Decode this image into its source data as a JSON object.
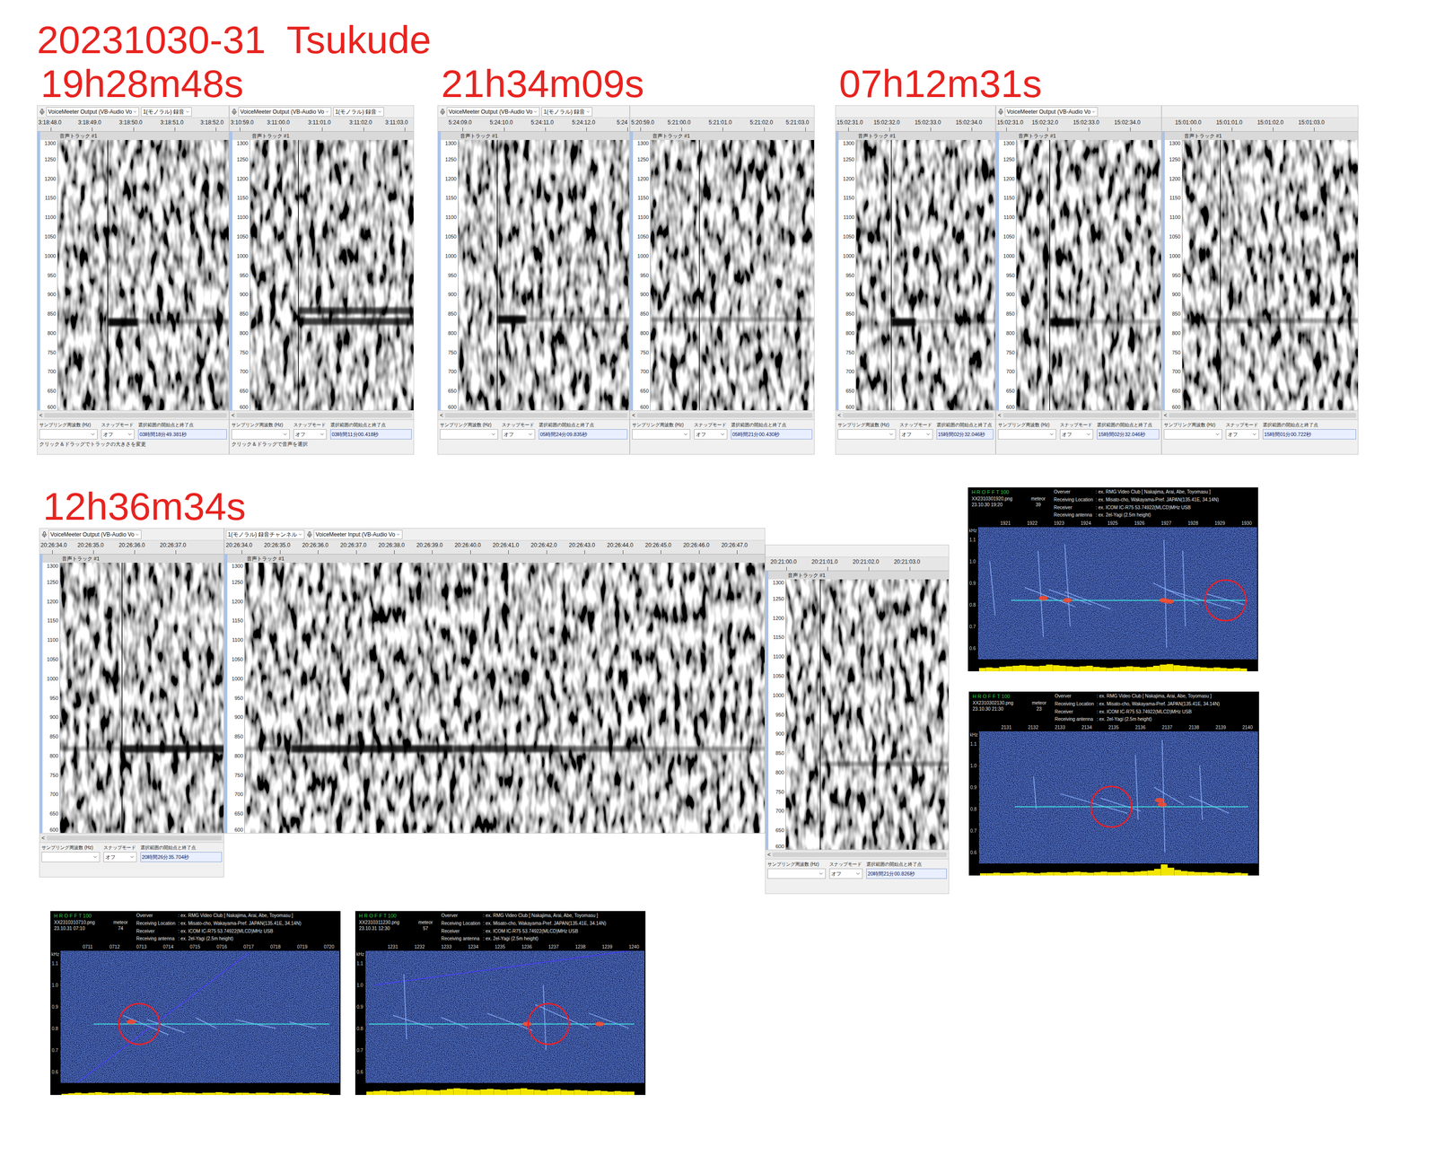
{
  "title": "20231030-31  Tsukude",
  "spectrogram_common": {
    "y_ticks": [
      "1300",
      "1250",
      "1200",
      "1150",
      "1100",
      "1050",
      "1000",
      "950",
      "900",
      "850",
      "800",
      "750",
      "700",
      "650",
      "600"
    ],
    "track_label": "音声トラック #1",
    "scroll_arrow": "<",
    "rate_label": "サンプリング周波数 (Hz)",
    "snap_label": "スナップモード",
    "selection_label": "選択範囲の開始点と終了点",
    "snap_value": "オフ"
  },
  "events": [
    {
      "label": "19h28m48s",
      "panels": [
        {
          "toolbar": [
            {
              "kind": "device",
              "text": "VoiceMeeter Output (VB-Audio Vo"
            },
            {
              "kind": "channels",
              "text": "1(モノラル) 録音"
            }
          ],
          "span": 4.67,
          "first_tick": 0.33,
          "ticks": [
            "3:18:48.0",
            "3:18:49.0",
            "3:18:50.0",
            "3:18:51.0",
            "3:18:52.0"
          ],
          "cursor": 1.71,
          "echoes": [
            {
              "from": 1.71,
              "to": 2.45,
              "freq": 828,
              "strength": 0.95
            },
            {
              "from": 2.45,
              "to": 4.67,
              "freq": 830,
              "strength": 0.3
            }
          ],
          "bottom": {
            "selection": "03時間18分49.381秒",
            "status": "クリック＆ドラッグでトラックの大きさを変更"
          }
        },
        {
          "toolbar": [
            {
              "kind": "device",
              "text": "VoiceMeeter Output (VB-Audio Vo"
            },
            {
              "kind": "channels",
              "text": "1(モノラル) 録音"
            }
          ],
          "span": 4.49,
          "first_tick": 0.25,
          "ticks": [
            "3:10:59.0",
            "3:11:00.0",
            "3:11:01.0",
            "3:11:02.0",
            "3:11:03.0"
          ],
          "cursor": 1.67,
          "echoes": [
            {
              "from": 1.67,
              "to": 4.49,
              "freq": 830,
              "strength": 0.75
            },
            {
              "from": 1.67,
              "to": 4.49,
              "freq": 858,
              "strength": 0.7
            }
          ],
          "bottom": {
            "selection": "03時間11分00.418秒",
            "status": "クリック＆ドラッグで音声を選択"
          }
        }
      ]
    },
    {
      "label": "21h34m09s",
      "panels": [
        {
          "toolbar": [
            {
              "kind": "device",
              "text": "VoiceMeeter Output (VB-Audio Vo"
            },
            {
              "kind": "channels",
              "text": "1(モノラル) 録音"
            }
          ],
          "span": 4.67,
          "first_tick": 0.6,
          "ticks": [
            "5:24:09.0",
            "5:24:10.0",
            "5:24:11.0",
            "5:24:12.0",
            "5:24"
          ],
          "cursor": 1.44,
          "echoes": [
            {
              "from": 1.44,
              "to": 2.15,
              "freq": 835,
              "strength": 0.95
            },
            {
              "from": 2.15,
              "to": 4.67,
              "freq": 835,
              "strength": 0.25
            }
          ],
          "bottom": {
            "selection": "05時間24分09.835秒"
          }
        },
        {
          "toolbar": [],
          "span": 4.49,
          "first_tick": 0.25,
          "ticks": [
            "5:20:59.0",
            "5:21:00.0",
            "5:21:01.0",
            "5:21:02.0",
            "5:21:03.0"
          ],
          "cursor": 1.68,
          "echoes": [
            {
              "from": 0,
              "to": 4.49,
              "freq": 835,
              "strength": 0.3
            }
          ],
          "bottom": {
            "selection": "05時間21分00.430秒"
          }
        }
      ]
    },
    {
      "label": "07h12m31s",
      "panels": [
        {
          "toolbar": [],
          "span": 3.9,
          "first_tick": 0.3,
          "ticks": [
            "15:02:31.0",
            "15:02:32.0",
            "15:02:33.0",
            "15:02:34.0"
          ],
          "cursor": 1.35,
          "echoes": [
            {
              "from": 1.35,
              "to": 1.95,
              "freq": 828,
              "strength": 0.95
            },
            {
              "from": 1.95,
              "to": 3.9,
              "freq": 830,
              "strength": 0.25
            }
          ],
          "bottom": {
            "selection": "15時間02分32.046秒"
          }
        },
        {
          "toolbar": [
            {
              "kind": "device",
              "text": "VoiceMeeter Output (VB-Audio Vo"
            }
          ],
          "span": 4.03,
          "first_tick": 0.25,
          "ticks": [
            "15:02:31.0",
            "15:02:32.0",
            "15:02:33.0",
            "15:02:34.0"
          ],
          "cursor": 1.3,
          "echoes": [
            {
              "from": 1.3,
              "to": 1.9,
              "freq": 828,
              "strength": 0.95
            },
            {
              "from": 1.9,
              "to": 4.03,
              "freq": 830,
              "strength": 0.25
            }
          ],
          "bottom": {
            "selection": "15時間02分32.046秒"
          }
        },
        {
          "toolbar": [],
          "span": 4.79,
          "first_tick": 0.7,
          "ticks": [
            "15:01:00.0",
            "15:01:01.0",
            "15:01:02.0",
            "15:01:03.0"
          ],
          "cursor": 1.42,
          "echoes": [
            {
              "from": 0.5,
              "to": 4.79,
              "freq": 832,
              "strength": 0.35
            }
          ],
          "bottom": {
            "selection": "15時間01分00.722秒"
          }
        }
      ]
    },
    {
      "label": "12h36m34s",
      "panels": [
        {
          "toolbar": [
            {
              "kind": "device",
              "text": "VoiceMeeter Output (VB-Audio Vo"
            }
          ],
          "span": 4.49,
          "first_tick": 0.3,
          "ticks": [
            "20:26:34.0",
            "20:26:35.0",
            "20:26:36.0",
            "20:26:37.0"
          ],
          "cursor": 2.0,
          "echoes": [
            {
              "from": 0,
              "to": 2.0,
              "freq": 818,
              "strength": 0.3
            },
            {
              "from": 2.0,
              "to": 4.49,
              "freq": 818,
              "strength": 0.85
            }
          ],
          "bottom": {
            "selection": "20時間26分35.704秒"
          }
        },
        {
          "toolbar": [
            {
              "kind": "channels",
              "text": "1(モノラル) 録音チャンネル"
            },
            {
              "kind": "device",
              "text": "VoiceMeeter Input (VB-Audio Vo"
            }
          ],
          "span": 14.2,
          "first_tick": 0.45,
          "ticks": [
            "20:26:34.0",
            "20:26:35.0",
            "20:26:36.0",
            "20:26:37.0",
            "20:26:38.0",
            "20:26:39.0",
            "20:26:40.0",
            "20:26:41.0",
            "20:26:42.0",
            "20:26:43.0",
            "20:26:44.0",
            "20:26:45.0",
            "20:26:46.0",
            "20:26:47.0"
          ],
          "echoes": [
            {
              "from": 0,
              "to": 1.75,
              "freq": 818,
              "strength": 0.3
            },
            {
              "from": 1.75,
              "to": 6.0,
              "freq": 818,
              "strength": 0.85
            },
            {
              "from": 6.0,
              "to": 8.8,
              "freq": 818,
              "strength": 0.75
            },
            {
              "from": 8.8,
              "to": 10.95,
              "freq": 818,
              "strength": 0.55
            },
            {
              "from": 10.95,
              "to": 14.2,
              "freq": 818,
              "strength": 0.3
            }
          ]
        },
        {
          "toolbar": [],
          "span": 4.47,
          "first_tick": 0.5,
          "ticks": [
            "20:21:00.0",
            "20:21:01.0",
            "20:21:02.0",
            "20:21:03.0"
          ],
          "cursor": 1.33,
          "echoes": [
            {
              "from": 1.33,
              "to": 4.47,
              "freq": 822,
              "strength": 0.35
            }
          ],
          "bottom": {
            "selection": "20時間21分00.826秒"
          }
        }
      ]
    }
  ],
  "hrofft": {
    "title": "H R O F F T 100",
    "meteor_label": "meteor",
    "y_unit": "kHz",
    "y_ticks": [
      "1.1",
      "1.0",
      "0.9",
      "0.8",
      "0.7",
      "0.6"
    ],
    "info": [
      {
        "key": "Overver",
        "value": ": ex. RMG Video Club [ Nakajima, Arai, Abe, Toyomasu ]"
      },
      {
        "key": "Receiving Location",
        "value": ": ex. Misato-cho, Wakayama-Pref. JAPAN(135.41E, 34.14N)"
      },
      {
        "key": "Receiver",
        "value": ": ex. ICOM IC-R75 53.74922(MLCD)MHz USB"
      },
      {
        "key": "Receiving antenna",
        "value": ": ex. 2el-Yagi (2.5m height)"
      }
    ],
    "plots": [
      {
        "file": "XX2310301920.png",
        "date": "23.10.30 19:20",
        "meteor_count": "39",
        "time_ticks": [
          "1921",
          "1922",
          "1923",
          "1924",
          "1925",
          "1926",
          "1927",
          "1928",
          "1929",
          "1930"
        ],
        "carrier": {
          "from": 1.2,
          "freq": 0.82
        },
        "streaks": [
          [
            1.7,
            0.88,
            3.6,
            0.79
          ],
          [
            2.6,
            0.87,
            4.2,
            0.8
          ],
          [
            3.2,
            0.86,
            4.9,
            0.78
          ],
          [
            6.5,
            0.9,
            8.2,
            0.8
          ],
          [
            7.0,
            0.87,
            9.4,
            0.78
          ],
          [
            8.5,
            0.85,
            9.9,
            0.8
          ],
          [
            2.2,
            1.05,
            2.4,
            0.65
          ],
          [
            3.2,
            1.08,
            3.4,
            0.7
          ],
          [
            6.9,
            1.1,
            7.0,
            0.6
          ],
          [
            7.6,
            1.05,
            7.7,
            0.7
          ],
          [
            0.4,
            1.0,
            0.6,
            0.75
          ]
        ],
        "blobs": [
          [
            2.4,
            0.83
          ],
          [
            3.3,
            0.82
          ],
          [
            6.9,
            0.82
          ],
          [
            7.1,
            0.815
          ]
        ],
        "sweeps": [],
        "circle": {
          "t": 9.2,
          "freq": 0.82
        },
        "activity": [
          0.3,
          0.35,
          0.3,
          0.4,
          0.45,
          0.5,
          0.55,
          0.5,
          0.45,
          0.5,
          0.6,
          0.55,
          0.5,
          0.45,
          0.4,
          0.45,
          0.5,
          0.4,
          0.35,
          0.3,
          0.35,
          0.4,
          0.45,
          0.4,
          0.35,
          0.4,
          0.5,
          0.6,
          0.65,
          0.55,
          0.5,
          0.45,
          0.4,
          0.35,
          0.3,
          0.35,
          0.3,
          0.25,
          0.3,
          0.25
        ]
      },
      {
        "file": "XX2310302130.png",
        "date": "23.10.30 21:30",
        "meteor_count": "23",
        "time_ticks": [
          "2131",
          "2132",
          "2133",
          "2134",
          "2135",
          "2136",
          "2137",
          "2138",
          "2139",
          "2140"
        ],
        "carrier": {
          "from": 1.3,
          "freq": 0.81
        },
        "streaks": [
          [
            3.0,
            0.87,
            5.5,
            0.78
          ],
          [
            4.5,
            0.85,
            6.0,
            0.79
          ],
          [
            6.5,
            0.9,
            7.6,
            0.82
          ],
          [
            7.8,
            0.86,
            9.3,
            0.78
          ],
          [
            2.0,
            0.95,
            2.1,
            0.8
          ],
          [
            6.8,
            1.12,
            6.9,
            0.6
          ],
          [
            5.8,
            1.05,
            5.9,
            0.75
          ],
          [
            8.2,
            1.0,
            8.3,
            0.75
          ]
        ],
        "blobs": [
          [
            6.8,
            0.82
          ],
          [
            6.7,
            0.84
          ]
        ],
        "sweeps": [],
        "circle": {
          "t": 4.9,
          "freq": 0.81
        },
        "activity": [
          0.2,
          0.2,
          0.25,
          0.2,
          0.2,
          0.25,
          0.3,
          0.25,
          0.2,
          0.25,
          0.3,
          0.3,
          0.25,
          0.3,
          0.35,
          0.3,
          0.25,
          0.3,
          0.35,
          0.3,
          0.3,
          0.35,
          0.3,
          0.35,
          0.4,
          0.45,
          0.6,
          1.0,
          0.7,
          0.5,
          0.4,
          0.35,
          0.3,
          0.3,
          0.25,
          0.3,
          0.25,
          0.2,
          0.25,
          0.2
        ]
      },
      {
        "file": "XX2310310710.png",
        "date": "23.10.31 07:10",
        "meteor_count": "74",
        "time_ticks": [
          "0711",
          "0712",
          "0713",
          "0714",
          "0715",
          "0716",
          "0717",
          "0718",
          "0719",
          "0720"
        ],
        "carrier": {
          "from": 1.2,
          "freq": 0.82
        },
        "streaks": [
          [
            2.3,
            0.86,
            4.0,
            0.77
          ],
          [
            3.2,
            0.84,
            4.6,
            0.78
          ],
          [
            5.0,
            0.85,
            5.8,
            0.8
          ],
          [
            6.5,
            0.84,
            8.0,
            0.8
          ],
          [
            8.5,
            0.83,
            9.5,
            0.8
          ]
        ],
        "blobs": [
          [
            2.6,
            0.83
          ]
        ],
        "sweeps": [
          [
            0.6,
            0.55,
            7.0,
            1.15
          ]
        ],
        "circle": {
          "t": 2.9,
          "freq": 0.82
        },
        "activity": [
          0.1,
          0.15,
          0.2,
          0.15,
          0.2,
          0.25,
          0.2,
          0.15,
          0.2,
          0.2,
          0.25,
          0.2,
          0.15,
          0.2,
          0.2,
          0.15,
          0.2,
          0.25,
          0.2,
          0.2,
          0.15,
          0.2,
          0.2,
          0.25,
          0.2,
          0.15,
          0.2,
          0.2,
          0.15,
          0.2,
          0.2,
          0.15,
          0.2,
          0.2,
          0.15,
          0.2,
          0.15,
          0.2,
          0.15,
          0.1
        ]
      },
      {
        "file": "XX2310311230.png",
        "date": "23.10.31 12:30",
        "meteor_count": "57",
        "time_ticks": [
          "1231",
          "1232",
          "1233",
          "1234",
          "1235",
          "1236",
          "1237",
          "1238",
          "1239",
          "1240"
        ],
        "carrier": {
          "from": 0.1,
          "freq": 0.82
        },
        "streaks": [
          [
            1.0,
            0.86,
            2.5,
            0.8
          ],
          [
            2.8,
            0.85,
            3.8,
            0.8
          ],
          [
            4.5,
            0.87,
            6.2,
            0.79
          ],
          [
            6.3,
            0.91,
            8.3,
            0.8
          ],
          [
            8.3,
            0.87,
            9.8,
            0.8
          ],
          [
            1.4,
            1.05,
            1.5,
            0.75
          ],
          [
            6.6,
            1.0,
            6.7,
            0.7
          ]
        ],
        "blobs": [
          [
            6.0,
            0.82
          ],
          [
            8.7,
            0.82
          ]
        ],
        "sweeps": [
          [
            0.3,
            1.0,
            9.9,
            1.16
          ]
        ],
        "circle": {
          "t": 6.8,
          "freq": 0.82
        },
        "activity": [
          0.3,
          0.35,
          0.4,
          0.35,
          0.3,
          0.35,
          0.4,
          0.45,
          0.5,
          0.45,
          0.4,
          0.45,
          0.55,
          0.6,
          0.55,
          0.5,
          0.45,
          0.5,
          0.55,
          0.5,
          0.45,
          0.5,
          0.55,
          0.6,
          0.5,
          0.45,
          0.4,
          0.5,
          0.55,
          0.45,
          0.4,
          0.45,
          0.4,
          0.35,
          0.4,
          0.35,
          0.3,
          0.35,
          0.3,
          0.3
        ]
      }
    ]
  }
}
